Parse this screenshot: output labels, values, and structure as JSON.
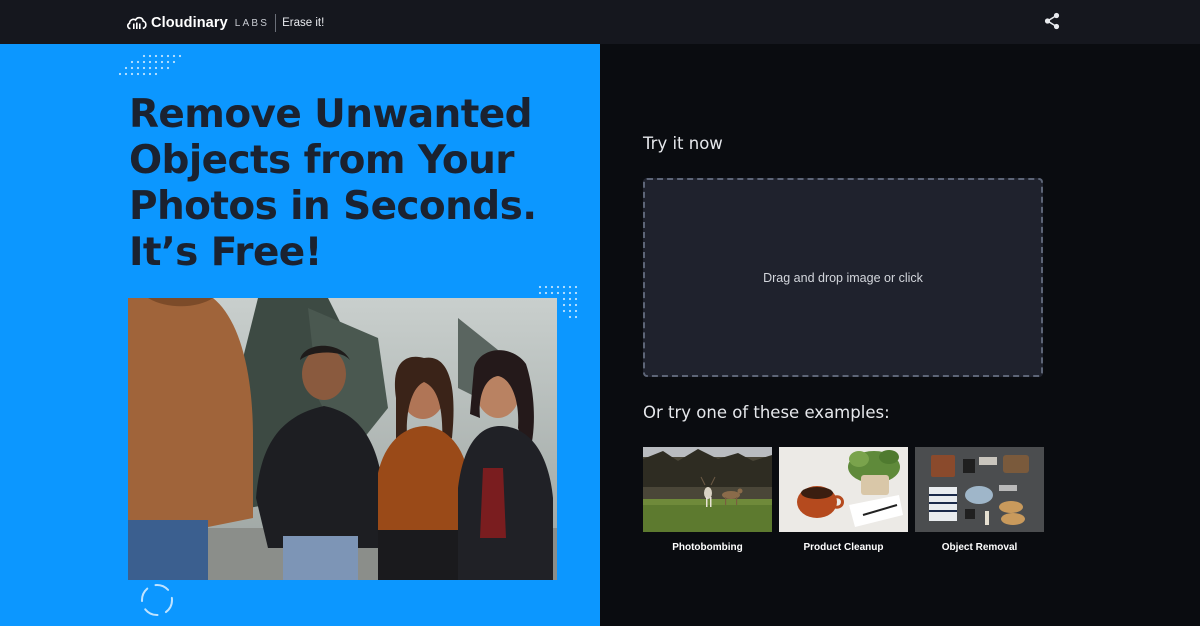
{
  "header": {
    "brand_name": "Cloudinary",
    "labs_label": "LABS",
    "product_name": "Erase it!",
    "share_icon": "share-icon",
    "background_color": "#15171e"
  },
  "hero": {
    "background_color": "#0c97ff",
    "headline_lines": [
      "Remove Unwanted",
      "Objects from Your",
      "Photos in Seconds.",
      "It’s Free!"
    ],
    "image_subject": "four-friends-laughing-photo",
    "loader_icon": "loading-spinner-icon"
  },
  "panel": {
    "try_title": "Try it now",
    "dropzone_text": "Drag and drop image or click",
    "examples_title": "Or try one of these examples:",
    "examples": [
      {
        "label": "Photobombing",
        "icon": "deer-photo"
      },
      {
        "label": "Product Cleanup",
        "icon": "coffee-plant-photo"
      },
      {
        "label": "Object Removal",
        "icon": "flatlay-items-photo"
      }
    ]
  }
}
